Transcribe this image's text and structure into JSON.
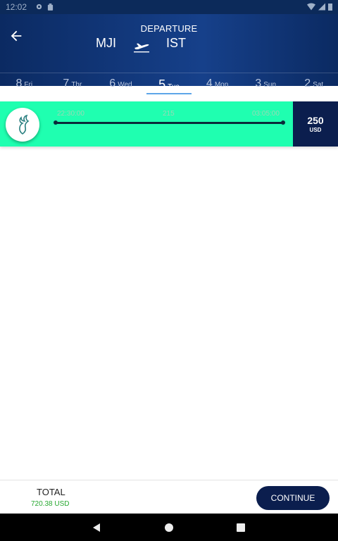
{
  "status_bar": {
    "time": "12:02"
  },
  "header": {
    "title": "DEPARTURE",
    "origin": "MJI",
    "destination": "IST"
  },
  "dates": [
    {
      "day": "8",
      "weekday": "Fri"
    },
    {
      "day": "7",
      "weekday": "Thr"
    },
    {
      "day": "6",
      "weekday": "Wed"
    },
    {
      "day": "5",
      "weekday": "Tue",
      "selected": true
    },
    {
      "day": "4",
      "weekday": "Mon"
    },
    {
      "day": "3",
      "weekday": "Sun"
    },
    {
      "day": "2",
      "weekday": "Sat"
    }
  ],
  "flight": {
    "departure_time": "22:30:00",
    "duration": "215",
    "arrival_time": "03:05:00",
    "price": "250",
    "currency": "USD",
    "card_color": "#1fffb0"
  },
  "footer": {
    "total_label": "TOTAL",
    "total_amount": "720.38 USD",
    "continue_label": "CONTINUE"
  },
  "colors": {
    "header": "#0b2a62",
    "accent": "#0b1e4e",
    "total_green": "#27a830"
  }
}
